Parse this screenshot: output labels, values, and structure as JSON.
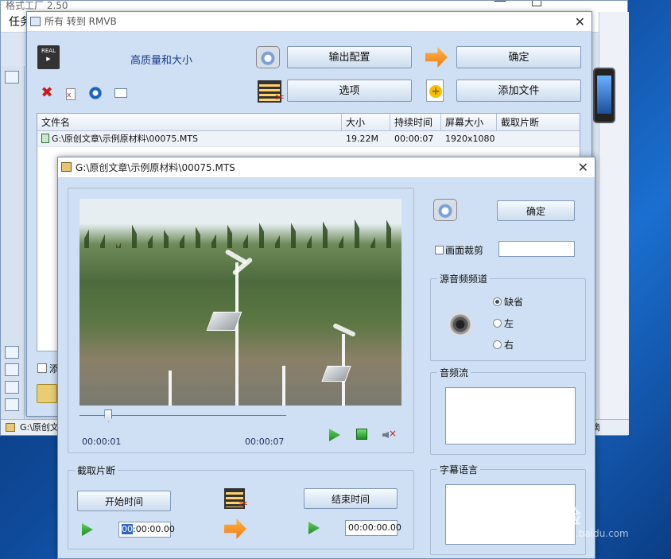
{
  "background_app": {
    "title": "格式工厂  2.50",
    "menu_fragment": "任务",
    "check_label_fragment": "添",
    "status_left": "G:\\原创文",
    "status_right": "滴"
  },
  "main_dialog": {
    "title": "所有 转到 RMVB",
    "quality_label": "高质量和大小",
    "buttons": {
      "output_config": "输出配置",
      "ok": "确定",
      "options": "选项",
      "add_file": "添加文件"
    },
    "file_list": {
      "columns": [
        "文件名",
        "大小",
        "持续时间",
        "屏幕大小",
        "截取片断"
      ],
      "rows": [
        {
          "name": "G:\\原创文章\\示例原材料\\00075.MTS",
          "size": "19.22M",
          "duration": "00:00:07",
          "screen": "1920x1080",
          "clip": ""
        }
      ]
    }
  },
  "clip_dialog": {
    "title": "G:\\原创文章\\示例原材料\\00075.MTS",
    "playback": {
      "current_time": "00:00:01",
      "total_time": "00:00:07",
      "position_fraction": 0.14
    },
    "ok_button": "确定",
    "crop_label": "画面裁剪",
    "audio_channel": {
      "legend": "源音频频道",
      "options": [
        "缺省",
        "左",
        "右"
      ],
      "selected": 0
    },
    "audio_stream_legend": "音频流",
    "subtitle_legend": "字幕语言",
    "clip_segment": {
      "legend": "截取片断",
      "start_button": "开始时间",
      "end_button": "结束时间",
      "start_value_sel": "00",
      "start_value_rest": ":00:00.00",
      "end_value": "00:00:00.00"
    }
  },
  "watermark": {
    "brand": "Bai经验",
    "url": "jingyan.baidu.com"
  },
  "colors": {
    "accent_blue": "#1a3c8c",
    "dialog_bg": "#cfe0f4",
    "play_green": "#1f8a1f",
    "delete_red": "#d01818"
  }
}
